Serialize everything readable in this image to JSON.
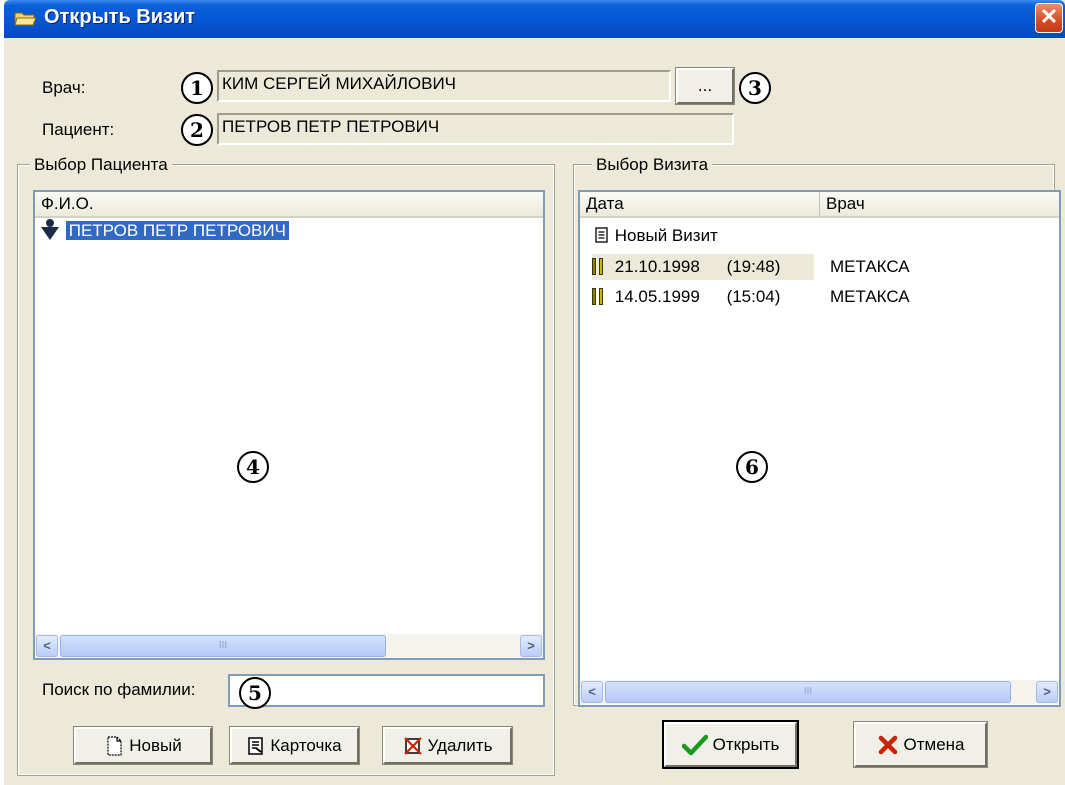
{
  "window": {
    "title": "Открыть Визит",
    "close_glyph": "✕"
  },
  "doctor": {
    "label": "Врач:",
    "value": "КИМ СЕРГЕЙ МИХАЙЛОВИЧ",
    "browse_label": "..."
  },
  "patient": {
    "label": "Пациент:",
    "value": "ПЕТРОВ ПЕТР ПЕТРОВИЧ"
  },
  "callouts": [
    "1",
    "2",
    "3",
    "4",
    "5",
    "6"
  ],
  "patient_group": {
    "title": "Выбор Пациента",
    "column": "Ф.И.О.",
    "rows": [
      {
        "name": "ПЕТРОВ ПЕТР ПЕТРОВИЧ",
        "icon": "patient-arrow-icon",
        "selected": true
      }
    ],
    "search_label": "Поиск по фамилии:",
    "search_value": ""
  },
  "visit_group": {
    "title": "Выбор Визита",
    "columns": [
      "Дата",
      "Врач"
    ],
    "new_visit": "Новый Визит",
    "rows": [
      {
        "date": "21.10.1998",
        "time": "(19:48)",
        "doctor": "МЕТАКСА",
        "icon": "visit-book-icon"
      },
      {
        "date": "14.05.1999",
        "time": "(15:04)",
        "doctor": "МЕТАКСА",
        "icon": "visit-book-icon"
      }
    ]
  },
  "buttons": {
    "new": "Новый",
    "card": "Карточка",
    "delete": "Удалить",
    "open": "Открыть",
    "cancel": "Отмена"
  },
  "scrollbar": {
    "left_arrow": "<",
    "right_arrow": ">",
    "grip": "III"
  },
  "colors": {
    "selection": "#316ac5",
    "title_bar": "#0656d4",
    "accent_red": "#cc2200",
    "accent_green": "#1a9a1a"
  }
}
